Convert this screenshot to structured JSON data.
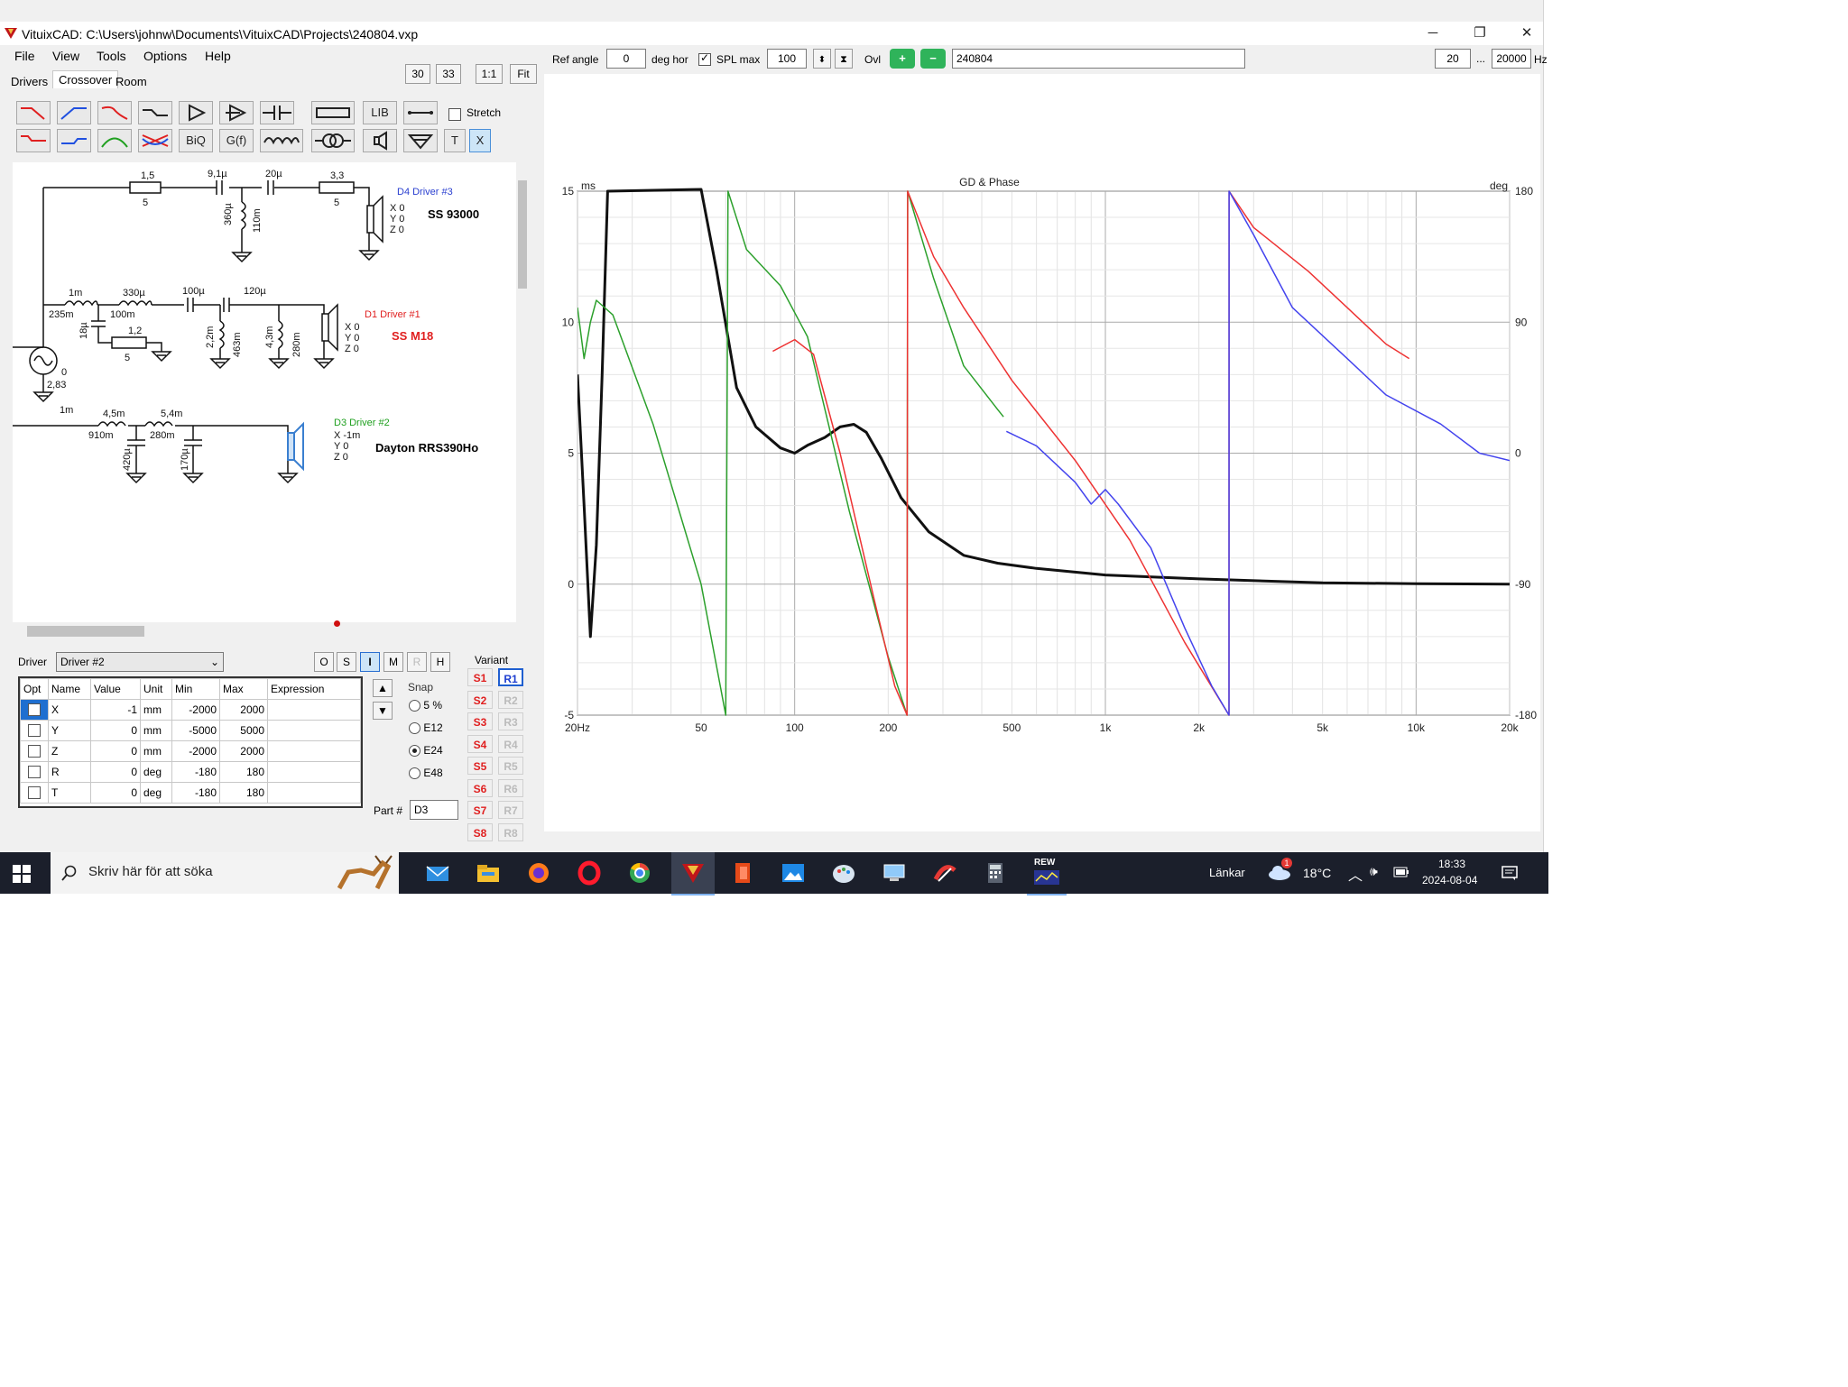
{
  "window": {
    "title": "VituixCAD: C:\\Users\\johnw\\Documents\\VituixCAD\\Projects\\240804.vxp",
    "minimize": "─",
    "restore": "❐",
    "close": "✕"
  },
  "menu": [
    "File",
    "View",
    "Tools",
    "Options",
    "Help"
  ],
  "tabs": [
    "Drivers",
    "Crossover",
    "Room"
  ],
  "active_tab": "Crossover",
  "view_buttons": [
    "30",
    "33",
    "1:1",
    "Fit"
  ],
  "toolbar": {
    "lib_label": "LIB",
    "stretch_label": "Stretch",
    "biq_label": "BiQ",
    "gf_label": "G(f)",
    "t_label": "T",
    "x_label": "X"
  },
  "top_controls": {
    "ref_angle_label": "Ref angle",
    "ref_angle_value": "0",
    "deg_hor_label": "deg hor",
    "spl_max_label": "SPL max",
    "spl_max_value": "100",
    "ovl_label": "Ovl",
    "overlay_name": "240804",
    "freq_min": "20",
    "freq_dots": "...",
    "freq_max": "20000",
    "hz_label": "Hz"
  },
  "schematic": {
    "d4": {
      "name": "D4 Driver #3",
      "model": "SS 93000",
      "coords": [
        "X 0",
        "Y 0",
        "Z 0"
      ]
    },
    "d1": {
      "name": "D1 Driver #1",
      "model": "SS M18",
      "coords": [
        "X 0",
        "Y 0",
        "Z 0"
      ]
    },
    "d3": {
      "name": "D3 Driver #2",
      "model": "Dayton RRS390Ho",
      "coords": [
        "X -1m",
        "Y 0",
        "Z 0"
      ]
    },
    "labels": {
      "r1_top": "1,5",
      "r1_bot": "5",
      "c1": "9,1µ",
      "c2": "20µ",
      "r2_top": "3,3",
      "r2_bot": "5",
      "l1a": "360µ",
      "l1b": "110m",
      "l2_top": "1m",
      "l2_bot": "235m",
      "l3_top": "330µ",
      "l3_bot": "100m",
      "c3": "100µ",
      "c4": "120µ",
      "c5": "18µ",
      "r3_top": "1,2",
      "r3_bot": "5",
      "l4a": "2,2m",
      "l4b": "463m",
      "l5a": "4,3m",
      "l5b": "280m",
      "src_v": "2,83",
      "src_0": "0",
      "src_r": "1m",
      "l6_top": "4,5m",
      "l6_bot": "910m",
      "l7_top": "5,4m",
      "l7_bot": "280m",
      "c6": "420µ",
      "c7": "170µ"
    }
  },
  "properties": {
    "driver_label": "Driver",
    "driver_value": "Driver #2",
    "mode_buttons": [
      "O",
      "S",
      "I",
      "M",
      "R",
      "H"
    ],
    "active_mode": "I",
    "columns": [
      "Opt",
      "Name",
      "Value",
      "Unit",
      "Min",
      "Max",
      "Expression"
    ],
    "rows": [
      {
        "name": "X",
        "value": "-1",
        "unit": "mm",
        "min": "-2000",
        "max": "2000",
        "expr": ""
      },
      {
        "name": "Y",
        "value": "0",
        "unit": "mm",
        "min": "-5000",
        "max": "5000",
        "expr": ""
      },
      {
        "name": "Z",
        "value": "0",
        "unit": "mm",
        "min": "-2000",
        "max": "2000",
        "expr": ""
      },
      {
        "name": "R",
        "value": "0",
        "unit": "deg",
        "min": "-180",
        "max": "180",
        "expr": ""
      },
      {
        "name": "T",
        "value": "0",
        "unit": "deg",
        "min": "-180",
        "max": "180",
        "expr": ""
      }
    ],
    "snap_label": "Snap",
    "snap_options": [
      "5 %",
      "E12",
      "E24",
      "E48"
    ],
    "snap_selected": "E24",
    "part_label": "Part #",
    "part_value": "D3",
    "variant_label": "Variant",
    "variant_s": [
      "S1",
      "S2",
      "S3",
      "S4",
      "S5",
      "S6",
      "S7",
      "S8"
    ],
    "variant_r": [
      "R1",
      "R2",
      "R3",
      "R4",
      "R5",
      "R6",
      "R7",
      "R8"
    ],
    "variant_active": "R1"
  },
  "chart_data": {
    "type": "line",
    "title": "GD & Phase",
    "xlabel": "",
    "ylabel": "ms",
    "y2label": "deg",
    "xscale": "log",
    "xlim": [
      20,
      20000
    ],
    "ylim": [
      -5,
      15
    ],
    "y2lim": [
      -180,
      180
    ],
    "x_ticks": [
      "20Hz",
      "50",
      "100",
      "200",
      "500",
      "1k",
      "2k",
      "5k",
      "10k",
      "20k"
    ],
    "x_tick_values": [
      20,
      50,
      100,
      200,
      500,
      1000,
      2000,
      5000,
      10000,
      20000
    ],
    "y_ticks": [
      "15",
      "10",
      "5",
      "0",
      "-5"
    ],
    "y2_ticks": [
      "180",
      "90",
      "0",
      "-90",
      "-180"
    ],
    "grid": true,
    "series": [
      {
        "axis": "y",
        "color": "#111111",
        "width": 3,
        "points": [
          [
            20,
            8
          ],
          [
            21,
            3
          ],
          [
            22,
            -2
          ],
          [
            23,
            1.5
          ],
          [
            24,
            8
          ],
          [
            25,
            15
          ],
          [
            50,
            16
          ],
          [
            56,
            12
          ],
          [
            65,
            7.5
          ],
          [
            75,
            6
          ],
          [
            90,
            5.2
          ],
          [
            100,
            5
          ],
          [
            110,
            5.3
          ],
          [
            125,
            5.6
          ],
          [
            140,
            6
          ],
          [
            155,
            6.1
          ],
          [
            170,
            5.8
          ],
          [
            190,
            4.8
          ],
          [
            220,
            3.3
          ],
          [
            270,
            2
          ],
          [
            350,
            1.1
          ],
          [
            450,
            0.8
          ],
          [
            600,
            0.6
          ],
          [
            1000,
            0.35
          ],
          [
            2000,
            0.2
          ],
          [
            5000,
            0.05
          ],
          [
            10000,
            0.02
          ],
          [
            20000,
            0
          ]
        ]
      },
      {
        "axis": "y2",
        "color": "#2ca02c",
        "width": 1.5,
        "points": [
          [
            20,
            100
          ],
          [
            21,
            65
          ],
          [
            22,
            90
          ],
          [
            23,
            105
          ],
          [
            26,
            95
          ],
          [
            35,
            20
          ],
          [
            50,
            -90
          ],
          [
            60,
            -180
          ],
          [
            61,
            180
          ],
          [
            70,
            140
          ],
          [
            90,
            115
          ],
          [
            110,
            80
          ],
          [
            150,
            -40
          ],
          [
            200,
            -140
          ],
          [
            230,
            -180
          ],
          [
            231,
            180
          ],
          [
            280,
            120
          ],
          [
            350,
            60
          ],
          [
            450,
            30
          ],
          [
            470,
            25
          ]
        ]
      },
      {
        "axis": "y2",
        "color": "#ee3333",
        "width": 1.5,
        "points": [
          [
            85,
            70
          ],
          [
            100,
            78
          ],
          [
            115,
            68
          ],
          [
            140,
            0
          ],
          [
            180,
            -100
          ],
          [
            210,
            -160
          ],
          [
            230,
            -180
          ],
          [
            231,
            180
          ],
          [
            280,
            135
          ],
          [
            350,
            100
          ],
          [
            500,
            50
          ],
          [
            800,
            -5
          ],
          [
            1200,
            -60
          ],
          [
            1800,
            -130
          ],
          [
            2500,
            -180
          ],
          [
            2501,
            180
          ],
          [
            3000,
            155
          ],
          [
            4500,
            125
          ],
          [
            6000,
            100
          ],
          [
            8000,
            75
          ],
          [
            9500,
            65
          ]
        ]
      },
      {
        "axis": "y2",
        "color": "#4444ee",
        "width": 1.5,
        "points": [
          [
            480,
            15
          ],
          [
            600,
            5
          ],
          [
            800,
            -20
          ],
          [
            900,
            -35
          ],
          [
            1000,
            -25
          ],
          [
            1100,
            -35
          ],
          [
            1400,
            -65
          ],
          [
            1800,
            -120
          ],
          [
            2200,
            -160
          ],
          [
            2500,
            -180
          ],
          [
            2501,
            180
          ],
          [
            3000,
            150
          ],
          [
            4000,
            100
          ],
          [
            6000,
            65
          ],
          [
            8000,
            40
          ],
          [
            12000,
            20
          ],
          [
            16000,
            0
          ],
          [
            20000,
            -5
          ]
        ]
      }
    ]
  },
  "taskbar": {
    "search_placeholder": "Skriv här för att söka",
    "links_label": "Länkar",
    "temperature": "18°C",
    "weather_badge": "1",
    "time": "18:33",
    "date": "2024-08-04",
    "rew_label": "REW"
  }
}
